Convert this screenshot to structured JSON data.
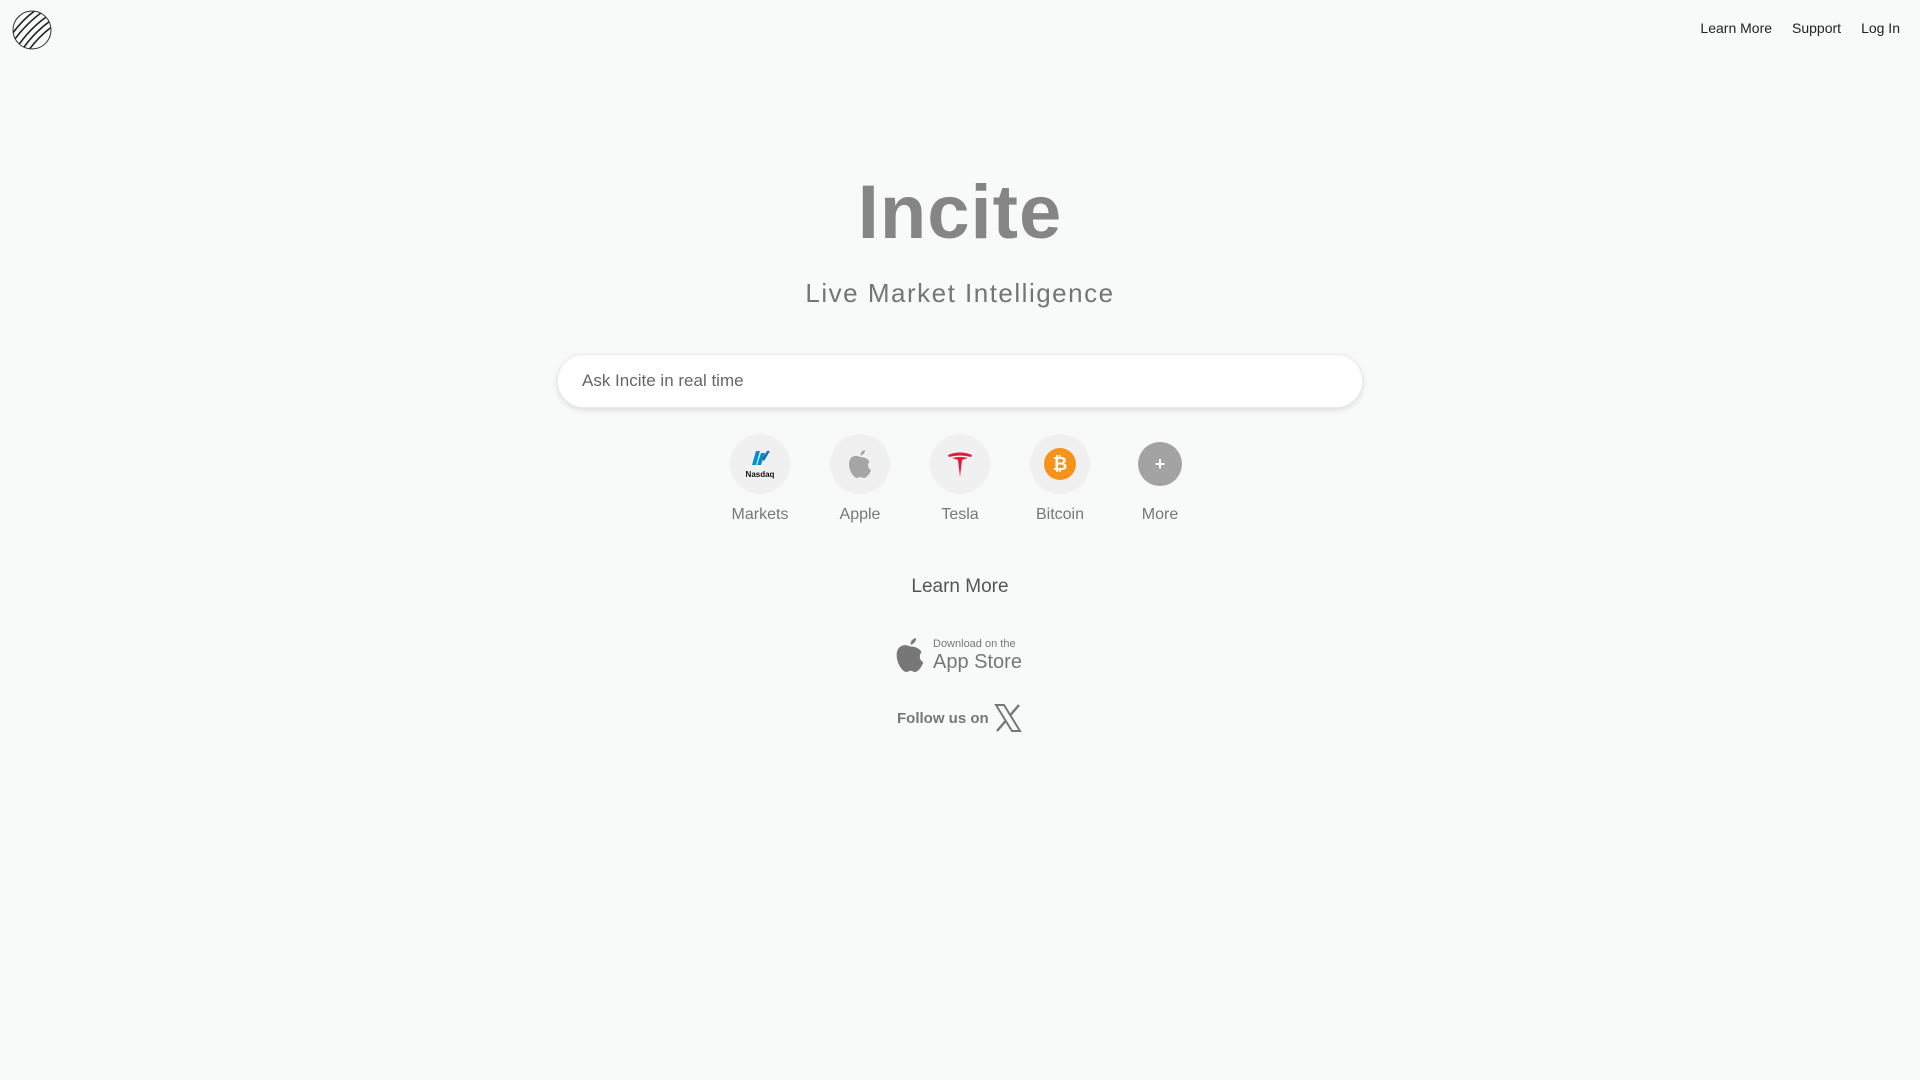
{
  "header": {
    "nav": [
      "Learn More",
      "Support",
      "Log In"
    ]
  },
  "hero": {
    "title": "Incite",
    "subtitle": "Live Market Intelligence"
  },
  "search": {
    "placeholder": "Ask Incite in real time",
    "value": ""
  },
  "quick_links": [
    {
      "label": "Markets",
      "icon": "nasdaq-icon",
      "icon_text": "Nasdaq",
      "color": "#0090d0"
    },
    {
      "label": "Apple",
      "icon": "apple-icon",
      "color": "#a5a5a5"
    },
    {
      "label": "Tesla",
      "icon": "tesla-icon",
      "color": "#e31937"
    },
    {
      "label": "Bitcoin",
      "icon": "bitcoin-icon",
      "color": "#f7931a"
    },
    {
      "label": "More",
      "icon": "plus-icon",
      "icon_text": "+",
      "color": "#a3a3a3"
    }
  ],
  "learn_more": "Learn More",
  "app_store": {
    "small": "Download on the",
    "big": "App Store"
  },
  "follow": {
    "label": "Follow us on"
  }
}
